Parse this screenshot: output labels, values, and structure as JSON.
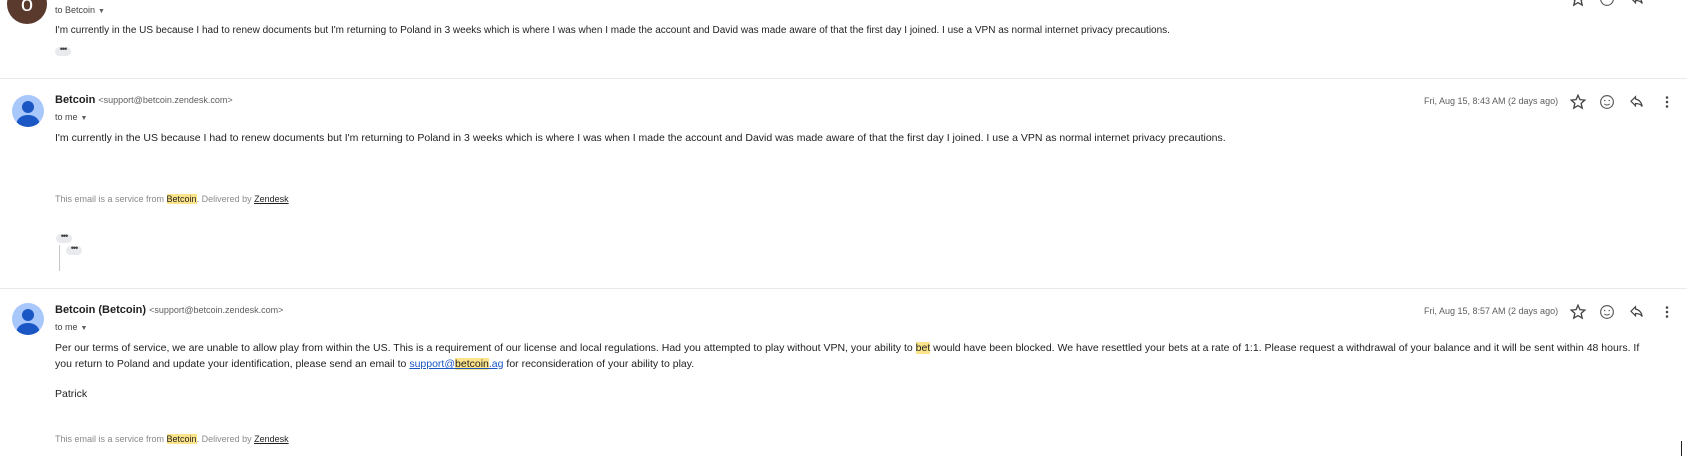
{
  "messages": [
    {
      "avatar_letter": "o",
      "to_line": "to Betcoin",
      "body": "I'm currently in the US because I had to renew documents but I'm returning to Poland in 3 weeks which is where I was when I made the account and David was made aware of that the first day I joined. I use a VPN as normal internet privacy precautions.",
      "dots": "•••"
    },
    {
      "sender_name": "Betcoin",
      "sender_email": "<support@betcoin.zendesk.com>",
      "to_line": "to me",
      "date": "Fri, Aug 15, 8:43 AM (2 days ago)",
      "body": "I'm currently in the US because I had to renew documents but I'm returning to Poland in 3 weeks which is where I was when I made the account and David was made aware of that the first day I joined. I use a VPN as normal internet privacy precautions.",
      "footer_prefix": "This email is a service from ",
      "footer_brand": "Betcoin",
      "footer_mid": ". Delivered by ",
      "footer_link": "Zendesk",
      "dots": "•••",
      "quoted_dots": "•••"
    },
    {
      "sender_name": "Betcoin (Betcoin)",
      "sender_email": "<support@betcoin.zendesk.com>",
      "to_line": "to me",
      "date": "Fri, Aug 15, 8:57 AM (2 days ago)",
      "body_part1": "Per our terms of service, we are unable to allow play from within the US. This is a requirement of our license and local regulations. Had you attempted to play without VPN, your ability to ",
      "body_hl": "bet",
      "body_part2": " would have been blocked. We have resettled your bets at a rate of 1:1. Please request a withdrawal of your balance and it will be sent within 48 hours. If you return to Poland and update your identification, please send an email to ",
      "body_link_a": "support@",
      "body_link_hl": "betcoin",
      "body_link_b": ".ag",
      "body_part3": " for reconsideration of your ability to play.",
      "signature": "Patrick",
      "footer_prefix": "This email is a service from ",
      "footer_brand": "Betcoin",
      "footer_mid": ". Delivered by ",
      "footer_link": "Zendesk"
    }
  ],
  "icons": [
    "star-icon",
    "emoji-icon",
    "reply-icon",
    "more-vert-icon",
    "person-icon",
    "caret-down-icon"
  ]
}
